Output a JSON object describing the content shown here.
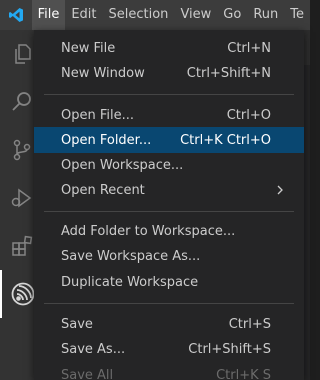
{
  "titlebar": {
    "logo_icon": "vscode-logo-icon",
    "menus": [
      "File",
      "Edit",
      "Selection",
      "View",
      "Go",
      "Run",
      "Te"
    ],
    "active_menu": "File"
  },
  "activitybar": {
    "icons": [
      "explorer-icon",
      "search-icon",
      "source-control-icon",
      "run-debug-icon",
      "extensions-icon",
      "espressif-icon"
    ]
  },
  "file_menu": {
    "items": [
      {
        "label": "New File",
        "shortcut": "Ctrl+N"
      },
      {
        "label": "New Window",
        "shortcut": "Ctrl+Shift+N"
      },
      {
        "label": "Open File...",
        "shortcut": "Ctrl+O"
      },
      {
        "label": "Open Folder...",
        "shortcut": "Ctrl+K Ctrl+O",
        "highlighted": true
      },
      {
        "label": "Open Workspace...",
        "shortcut": ""
      },
      {
        "label": "Open Recent",
        "shortcut": "",
        "submenu": true
      },
      {
        "label": "Add Folder to Workspace...",
        "shortcut": ""
      },
      {
        "label": "Save Workspace As...",
        "shortcut": ""
      },
      {
        "label": "Duplicate Workspace",
        "shortcut": ""
      },
      {
        "label": "Save",
        "shortcut": "Ctrl+S"
      },
      {
        "label": "Save As...",
        "shortcut": "Ctrl+Shift+S"
      },
      {
        "label": "Save All",
        "shortcut": "Ctrl+K S",
        "disabled": true
      }
    ]
  },
  "colors": {
    "highlight": "#094771",
    "titlebar": "#3c3c3c",
    "activitybar": "#333333",
    "menu_bg": "#252526",
    "logo_blue": "#23a9f2"
  }
}
